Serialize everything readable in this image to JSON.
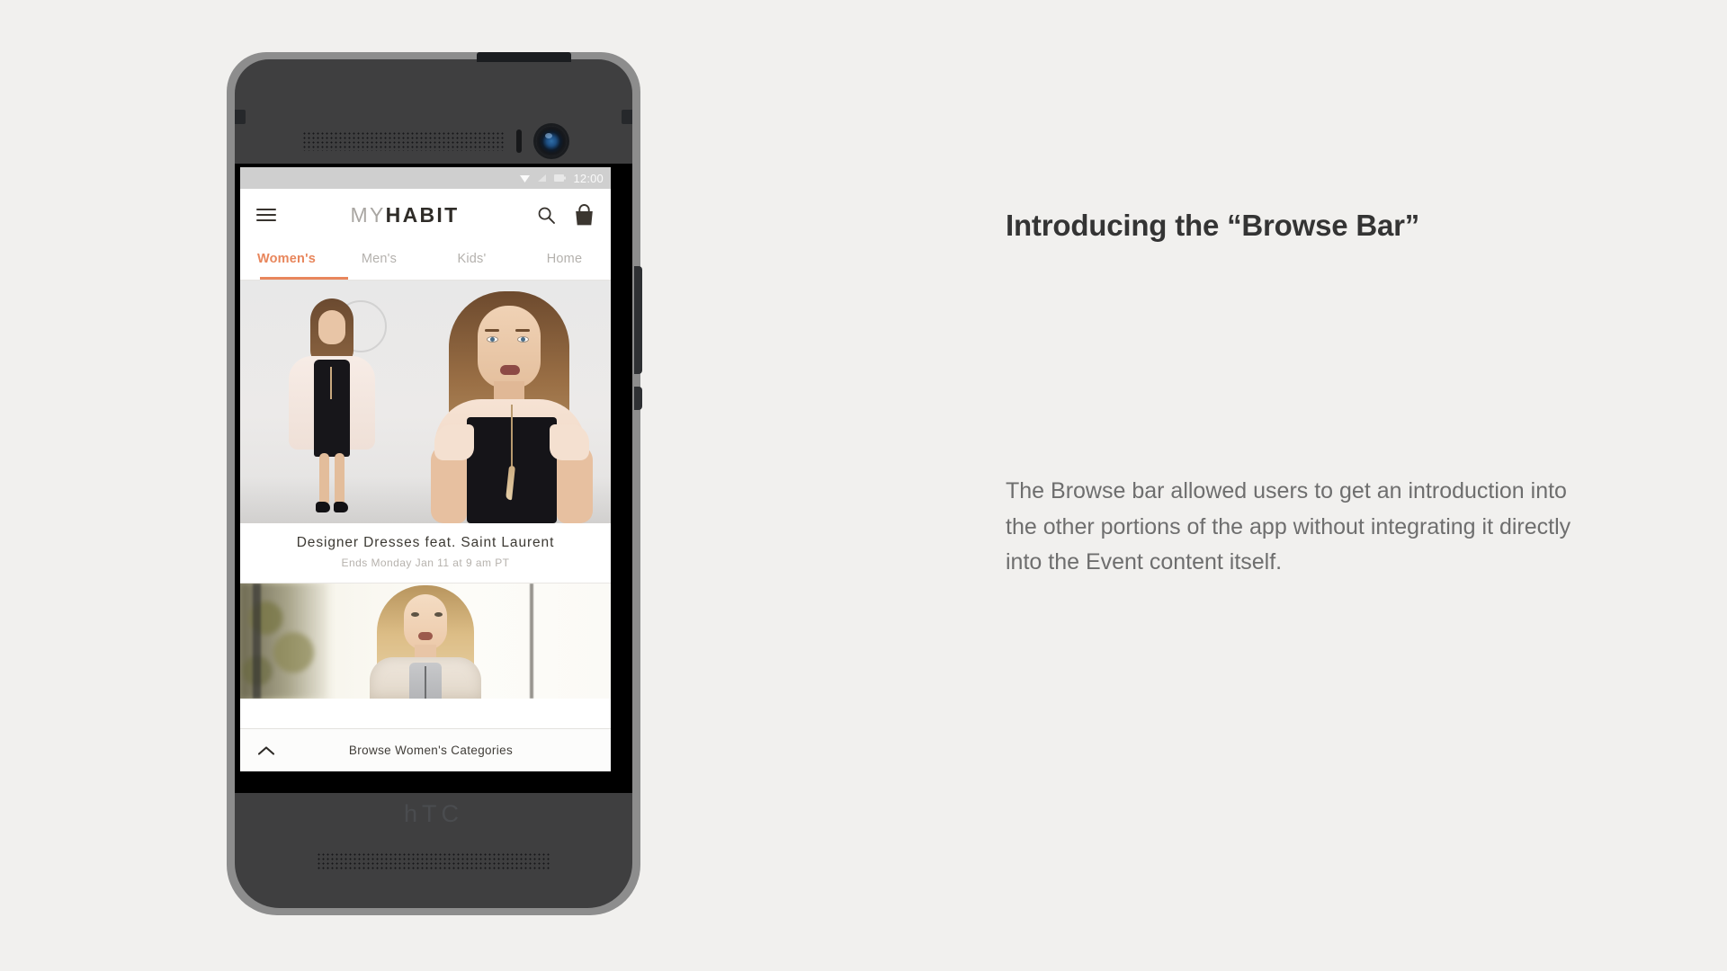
{
  "page": {
    "background_color": "#f1f0ee"
  },
  "copy": {
    "title": "Introducing the “Browse Bar”",
    "body": "The Browse bar allowed users to get an introduction into the other portions of the app without integrating it directly into the Event content itself.",
    "title_color": "#343434",
    "body_color": "#6e6e6e"
  },
  "device": {
    "brand_logo": "hTC",
    "chassis_color": "#3f3f40",
    "rim_color": "#8d8d8d",
    "icons": {
      "front_camera": "camera-icon",
      "earpiece": "speaker-grille-icon",
      "proximity_sensor": "sensor-icon",
      "power_button": "power-button",
      "volume_button": "volume-button"
    }
  },
  "screen": {
    "status_bar": {
      "time": "12:00",
      "background_color": "#cfcfcf",
      "icons": [
        "download-icon",
        "signal-icon",
        "battery-icon"
      ]
    },
    "app_bar": {
      "menu_icon": "hamburger-icon",
      "brand_first": "MY",
      "brand_second": "HABIT",
      "search_icon": "search-icon",
      "cart_icon": "shopping-bag-icon"
    },
    "tabs": {
      "accent_color": "#e8865c",
      "active_index": 0,
      "items": [
        {
          "label": "Women's"
        },
        {
          "label": "Men's"
        },
        {
          "label": "Kids'"
        },
        {
          "label": "Home"
        }
      ]
    },
    "events": [
      {
        "title": "Designer Dresses feat. Saint Laurent",
        "subtitle": "Ends Monday Jan 11 at 9 am PT",
        "image_alt": "Two models in black and blush color-block dresses"
      },
      {
        "image_alt": "Blonde model in textured cream jacket outdoors"
      }
    ],
    "browse_bar": {
      "label": "Browse Women's Categories",
      "chevron_icon": "chevron-up-icon",
      "background_color": "#fcfcfb"
    }
  }
}
